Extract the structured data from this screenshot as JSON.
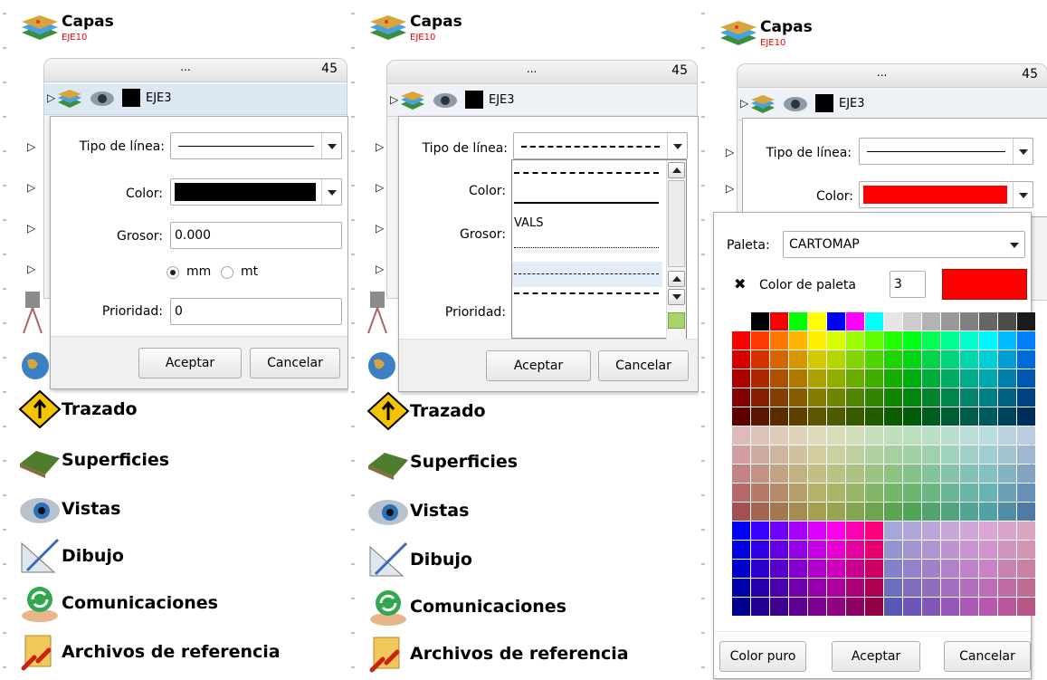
{
  "capas": {
    "title": "Capas",
    "subtitle": "EJE10"
  },
  "layers": {
    "dots": "...",
    "count": "45",
    "selected_name": "EJE3"
  },
  "sections": {
    "trazado": "Trazado",
    "superficies": "Superficies",
    "vistas": "Vistas",
    "dibujo": "Dibujo",
    "comunicaciones": "Comunicaciones",
    "archivos": "Archivos de referencia"
  },
  "dialog": {
    "tipo_label": "Tipo de línea:",
    "color_label": "Color:",
    "grosor_label": "Grosor:",
    "grosor_value": "0.000",
    "unit_mm": "mm",
    "unit_mt": "mt",
    "prioridad_label": "Prioridad:",
    "prioridad_value": "0",
    "ok": "Aceptar",
    "cancel": "Cancelar",
    "color_value": "#000000"
  },
  "dropdown": {
    "item_vals": "VALS"
  },
  "palette_dialog": {
    "color_value": "#ff0000",
    "paleta_label": "Paleta:",
    "paleta_value": "CARTOMAP",
    "color_paleta_label": "Color de paleta",
    "color_paleta_number": "3",
    "color_puro": "Color puro",
    "ok": "Aceptar",
    "cancel": "Cancelar"
  }
}
